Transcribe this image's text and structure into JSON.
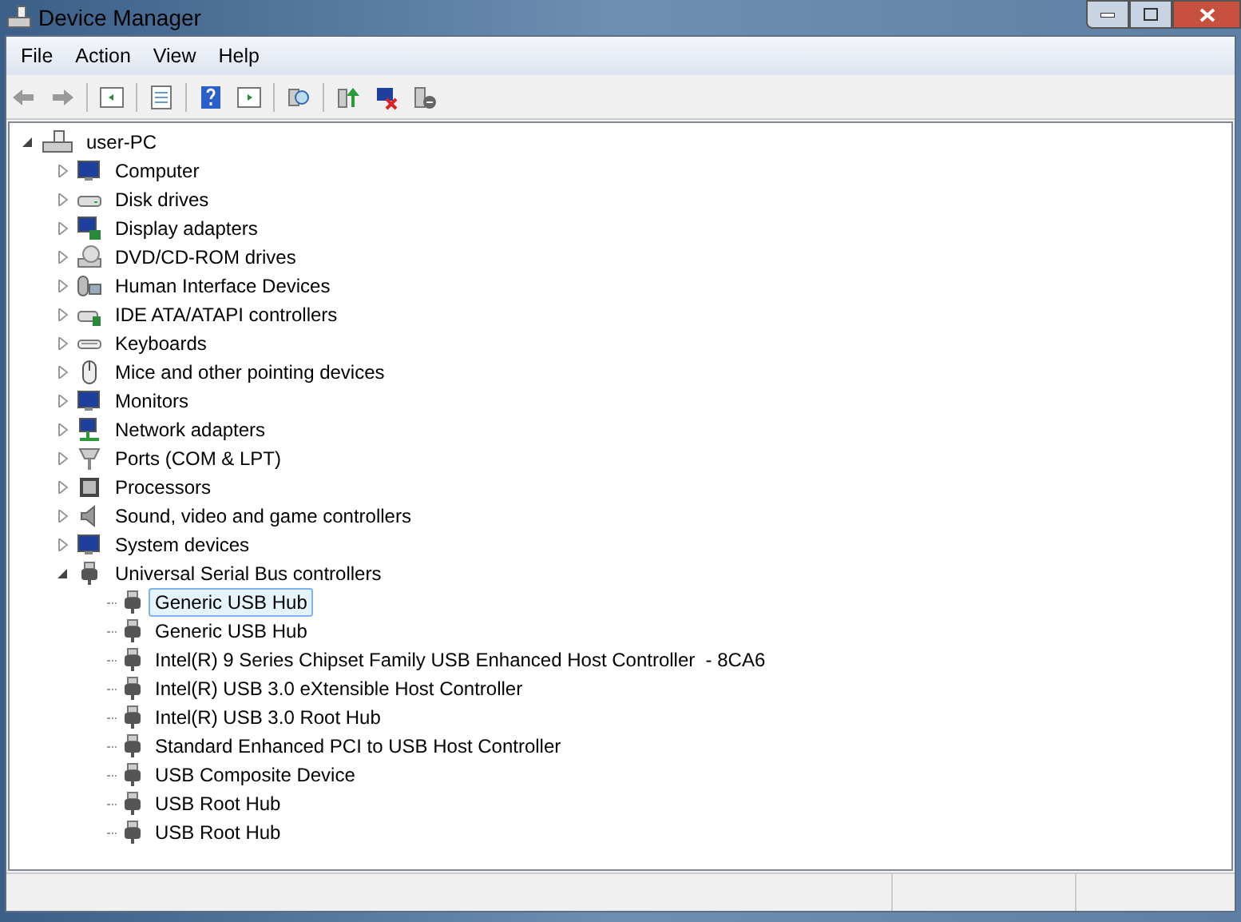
{
  "window": {
    "title": "Device Manager"
  },
  "menu": [
    "File",
    "Action",
    "View",
    "Help"
  ],
  "tree": {
    "label": "user-PC",
    "expanded": true,
    "children": [
      {
        "label": "Computer",
        "expanded": false
      },
      {
        "label": "Disk drives",
        "expanded": false
      },
      {
        "label": "Display adapters",
        "expanded": false
      },
      {
        "label": "DVD/CD-ROM drives",
        "expanded": false
      },
      {
        "label": "Human Interface Devices",
        "expanded": false
      },
      {
        "label": "IDE ATA/ATAPI controllers",
        "expanded": false
      },
      {
        "label": "Keyboards",
        "expanded": false
      },
      {
        "label": "Mice and other pointing devices",
        "expanded": false
      },
      {
        "label": "Monitors",
        "expanded": false
      },
      {
        "label": "Network adapters",
        "expanded": false
      },
      {
        "label": "Ports (COM & LPT)",
        "expanded": false
      },
      {
        "label": "Processors",
        "expanded": false
      },
      {
        "label": "Sound, video and game controllers",
        "expanded": false
      },
      {
        "label": "System devices",
        "expanded": false
      },
      {
        "label": "Universal Serial Bus controllers",
        "expanded": true,
        "children": [
          {
            "label": "Generic USB Hub",
            "selected": true
          },
          {
            "label": "Generic USB Hub",
            "selected": false
          },
          {
            "label": "Intel(R) 9 Series Chipset Family USB Enhanced Host Controller  - 8CA6",
            "selected": false
          },
          {
            "label": "Intel(R) USB 3.0 eXtensible Host Controller",
            "selected": false
          },
          {
            "label": "Intel(R) USB 3.0 Root Hub",
            "selected": false
          },
          {
            "label": "Standard Enhanced PCI to USB Host Controller",
            "selected": false
          },
          {
            "label": "USB Composite Device",
            "selected": false
          },
          {
            "label": "USB Root Hub",
            "selected": false
          },
          {
            "label": "USB Root Hub",
            "selected": false
          }
        ]
      }
    ]
  }
}
